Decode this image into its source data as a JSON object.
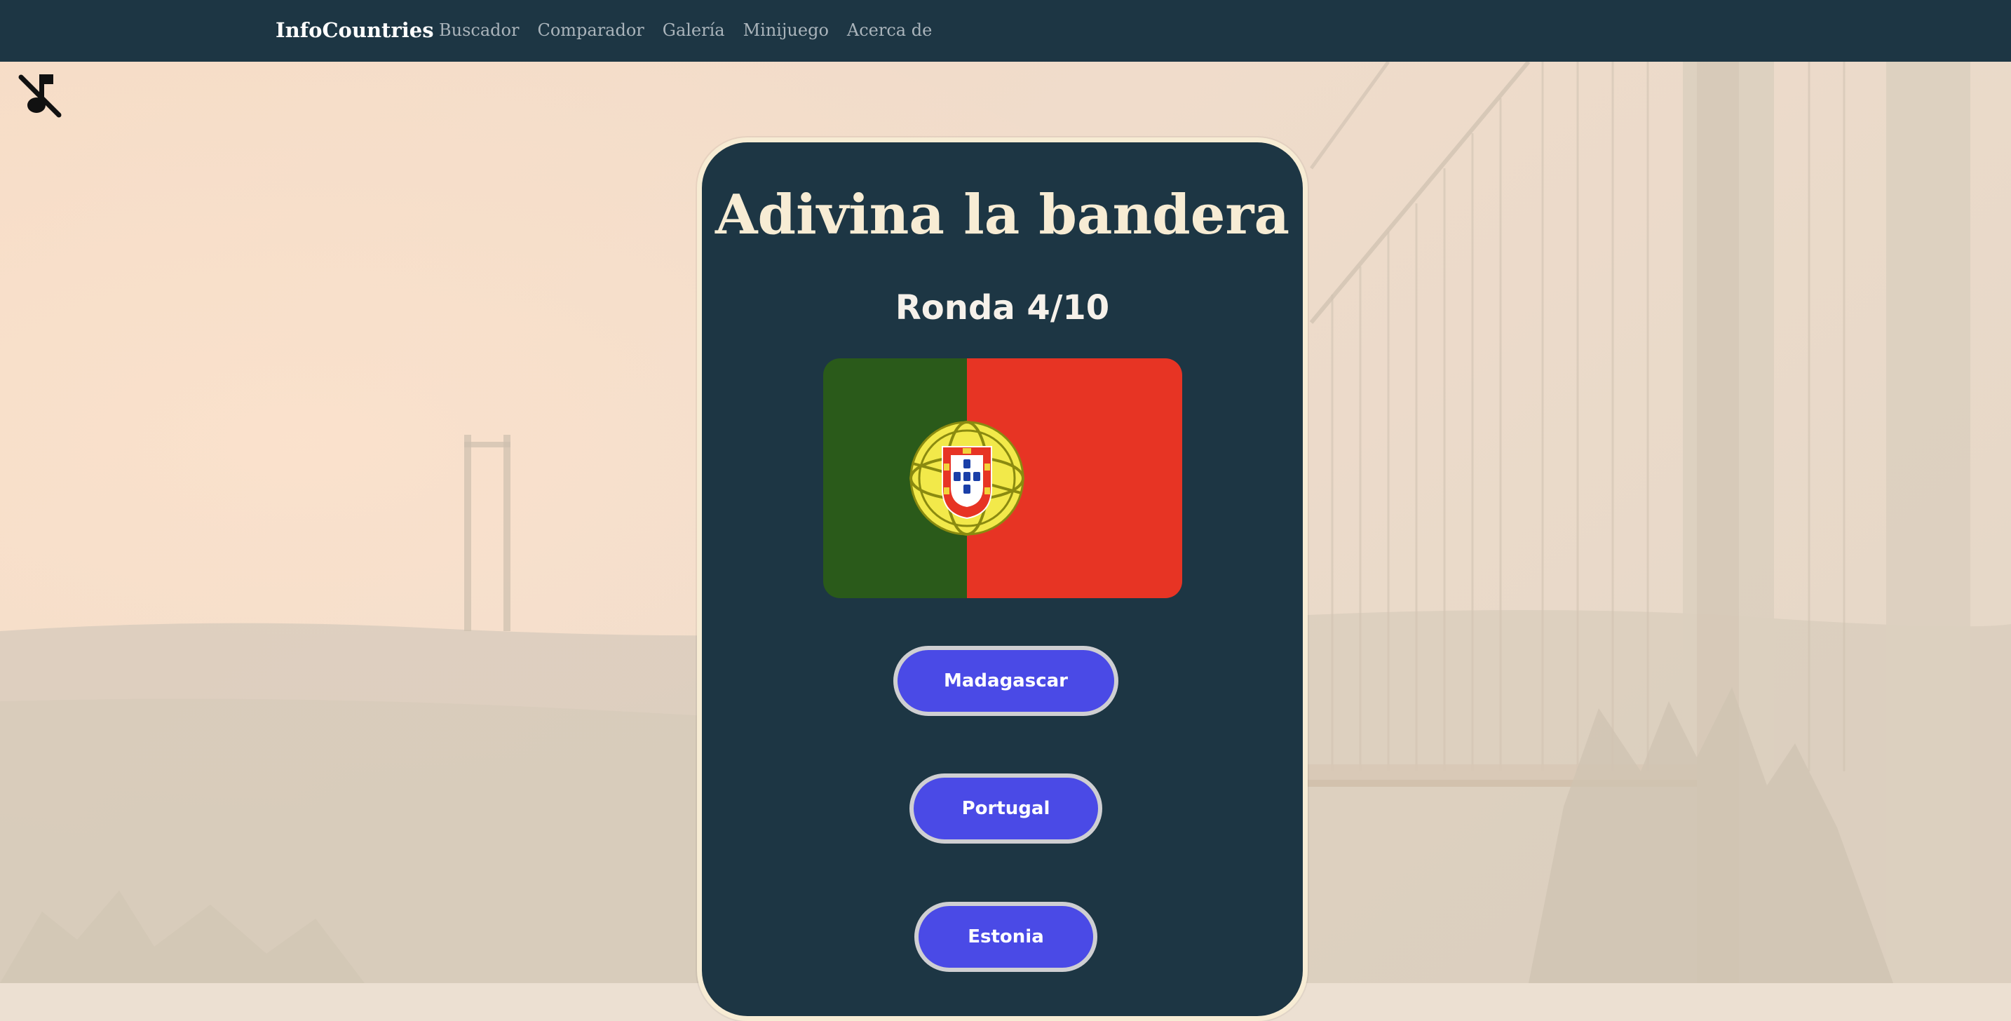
{
  "nav": {
    "brand": "InfoCountries",
    "links": [
      "Buscador",
      "Comparador",
      "Galería",
      "Minijuego",
      "Acerca de"
    ]
  },
  "music": {
    "icon": "music-off-icon"
  },
  "game": {
    "title": "Adivina la bandera",
    "round": "Ronda 4/10",
    "flag_icon": "portugal-flag",
    "options": [
      "Madagascar",
      "Portugal",
      "Estonia"
    ]
  },
  "colors": {
    "navbar": "#1d3644",
    "card": "#1d3644",
    "card_border": "#f7ecd4",
    "title": "#f7ecd4",
    "button": "#4a4ae6",
    "button_border": "#cfcfd2",
    "flag_green": "#2a5a1a",
    "flag_red": "#e73424"
  }
}
